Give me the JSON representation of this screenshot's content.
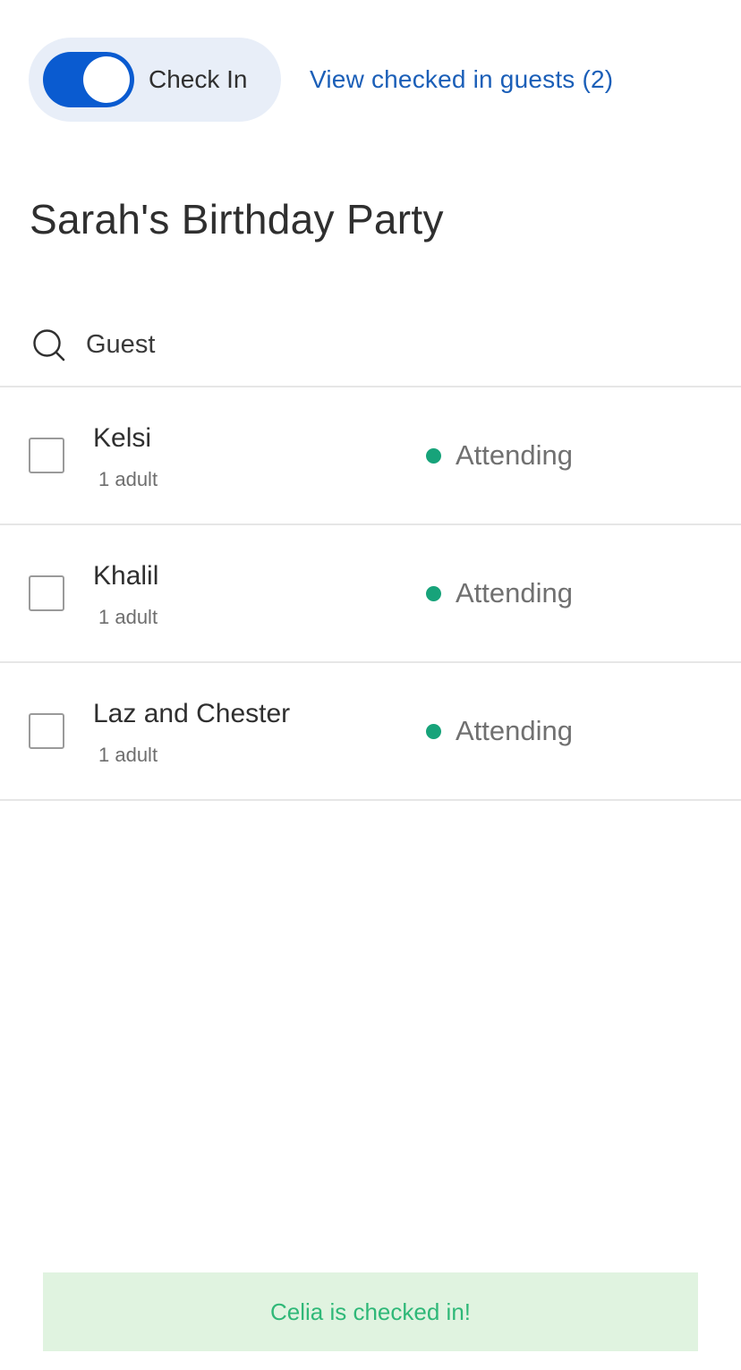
{
  "header": {
    "checkin_toggle": {
      "label": "Check In",
      "on": true,
      "color": "#0a5bd0"
    },
    "view_checked_link": "View checked in guests (2)"
  },
  "event": {
    "title": "Sarah's Birthday Party"
  },
  "search": {
    "placeholder": "Guest",
    "value": ""
  },
  "guests": [
    {
      "name": "Kelsi",
      "party": "1 adult",
      "status": "Attending"
    },
    {
      "name": "Khalil",
      "party": "1 adult",
      "status": "Attending"
    },
    {
      "name": "Laz and Chester",
      "party": "1 adult",
      "status": "Attending"
    }
  ],
  "colors": {
    "attending": "#17a37a",
    "link": "#1b5fb8",
    "toast_bg": "#e0f3e0",
    "toast_text": "#2fb878"
  },
  "toast": {
    "message": "Celia is checked in!"
  }
}
